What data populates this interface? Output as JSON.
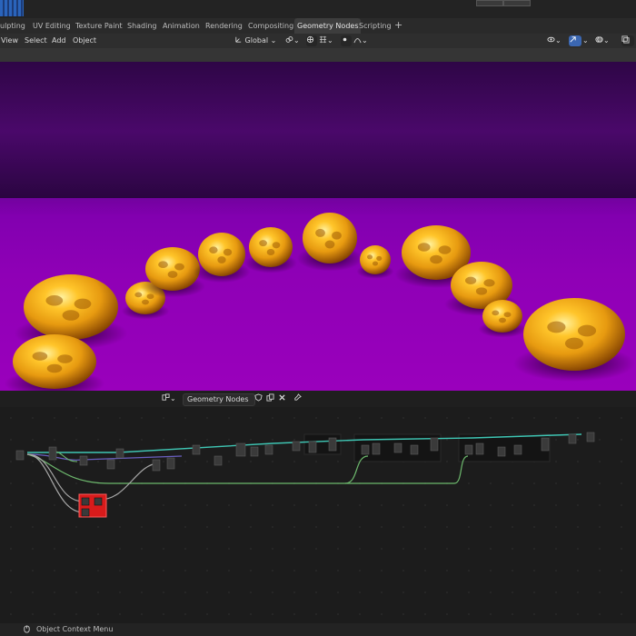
{
  "workspace_tabs": [
    {
      "label": "ulpting",
      "active": false
    },
    {
      "label": "UV Editing",
      "active": false
    },
    {
      "label": "Texture Paint",
      "active": false
    },
    {
      "label": "Shading",
      "active": false
    },
    {
      "label": "Animation",
      "active": false
    },
    {
      "label": "Rendering",
      "active": false
    },
    {
      "label": "Compositing",
      "active": false
    },
    {
      "label": "Geometry Nodes",
      "active": true
    },
    {
      "label": "Scripting",
      "active": false
    }
  ],
  "tab_add": "+",
  "viewport_header": {
    "menus": [
      "View",
      "Select",
      "Add",
      "Object"
    ],
    "transform_orientation": "Global"
  },
  "node_editor": {
    "node_group_name": "Geometry Nodes"
  },
  "status_bar": {
    "hint": "Object Context Menu"
  },
  "colors": {
    "accent_blue": "#3b67b2",
    "viewport_purple": "#8f00b6",
    "gold": "#f0a91c",
    "wire_teal": "#3fc6b4",
    "wire_green": "#6db86d",
    "selected_node_red": "#d81b1b"
  }
}
